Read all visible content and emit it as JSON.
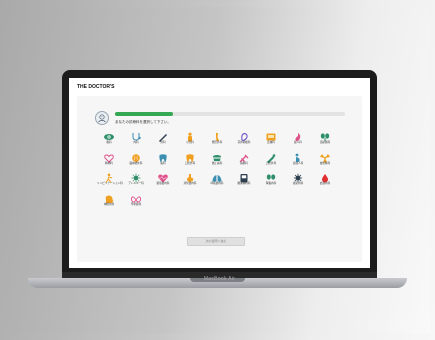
{
  "app": {
    "title": "THE DOCTOR'S"
  },
  "progress": {
    "label": "1/3",
    "fraction": 0.25
  },
  "prompt": "あなたの診療科を選択して下さい。",
  "device": {
    "model": "MacBook Air"
  },
  "next_button": {
    "label": "次の質問へ進む"
  },
  "colors": {
    "accent": "#35a853",
    "screen_bg": "#ffffff",
    "panel_bg": "#f6f6f6"
  },
  "departments": [
    {
      "label": "眼科",
      "icon": "eye-icon",
      "color": "#2f8f6a"
    },
    {
      "label": "内科",
      "icon": "stethoscope-icon",
      "color": "#3b8fb0"
    },
    {
      "label": "外科",
      "icon": "scalpel-icon",
      "color": "#2c3e50"
    },
    {
      "label": "小児科",
      "icon": "child-icon",
      "color": "#f0a020"
    },
    {
      "label": "整形外科",
      "icon": "bone-joint-icon",
      "color": "#f0a020"
    },
    {
      "label": "耳鼻咽喉科",
      "icon": "ear-icon",
      "color": "#7b61c9"
    },
    {
      "label": "皮膚科",
      "icon": "skin-icon",
      "color": "#f0a020"
    },
    {
      "label": "婦人科",
      "icon": "uterus-icon",
      "color": "#e0508a"
    },
    {
      "label": "泌尿器科",
      "icon": "kidney-icon",
      "color": "#2f8f6a"
    },
    {
      "label": "精神科",
      "icon": "mind-heart-icon",
      "color": "#e0508a"
    },
    {
      "label": "脳神経外科",
      "icon": "brain-icon",
      "color": "#f0a020"
    },
    {
      "label": "歯科",
      "icon": "tooth-icon",
      "color": "#3b8fb0"
    },
    {
      "label": "口腔外科",
      "icon": "mouth-tooth-icon",
      "color": "#f0a020"
    },
    {
      "label": "矯正歯科",
      "icon": "braces-icon",
      "color": "#2f8f6a"
    },
    {
      "label": "麻酔科",
      "icon": "syringe-icon",
      "color": "#e0508a"
    },
    {
      "label": "口腔外科",
      "icon": "mouth-tool-icon",
      "color": "#2f8f6a"
    },
    {
      "label": "産婦人科",
      "icon": "pregnancy-icon",
      "color": "#3b8fb0"
    },
    {
      "label": "放射線科",
      "icon": "radiation-icon",
      "color": "#f0a020"
    },
    {
      "label": "リハビリテーション科",
      "icon": "rehab-walker-icon",
      "color": "#f0a020"
    },
    {
      "label": "アレルギー科",
      "icon": "allergy-icon",
      "color": "#2f8f6a"
    },
    {
      "label": "循環器内科",
      "icon": "heart-pulse-icon",
      "color": "#e0508a"
    },
    {
      "label": "消化器内科",
      "icon": "stomach-icon",
      "color": "#f0a020"
    },
    {
      "label": "呼吸器内科",
      "icon": "lungs-icon",
      "color": "#3b8fb0"
    },
    {
      "label": "糖尿病内科",
      "icon": "glucose-meter-icon",
      "color": "#2c3e50"
    },
    {
      "label": "腎臓内科",
      "icon": "kidneys-icon",
      "color": "#2f8f6a"
    },
    {
      "label": "感染内科",
      "icon": "virus-icon",
      "color": "#2c3e50"
    },
    {
      "label": "血液内科",
      "icon": "blood-drop-icon",
      "color": "#e03030"
    },
    {
      "label": "神経内科",
      "icon": "head-brain-icon",
      "color": "#f0a020"
    },
    {
      "label": "甲状腺科",
      "icon": "thyroid-icon",
      "color": "#e0508a"
    }
  ]
}
